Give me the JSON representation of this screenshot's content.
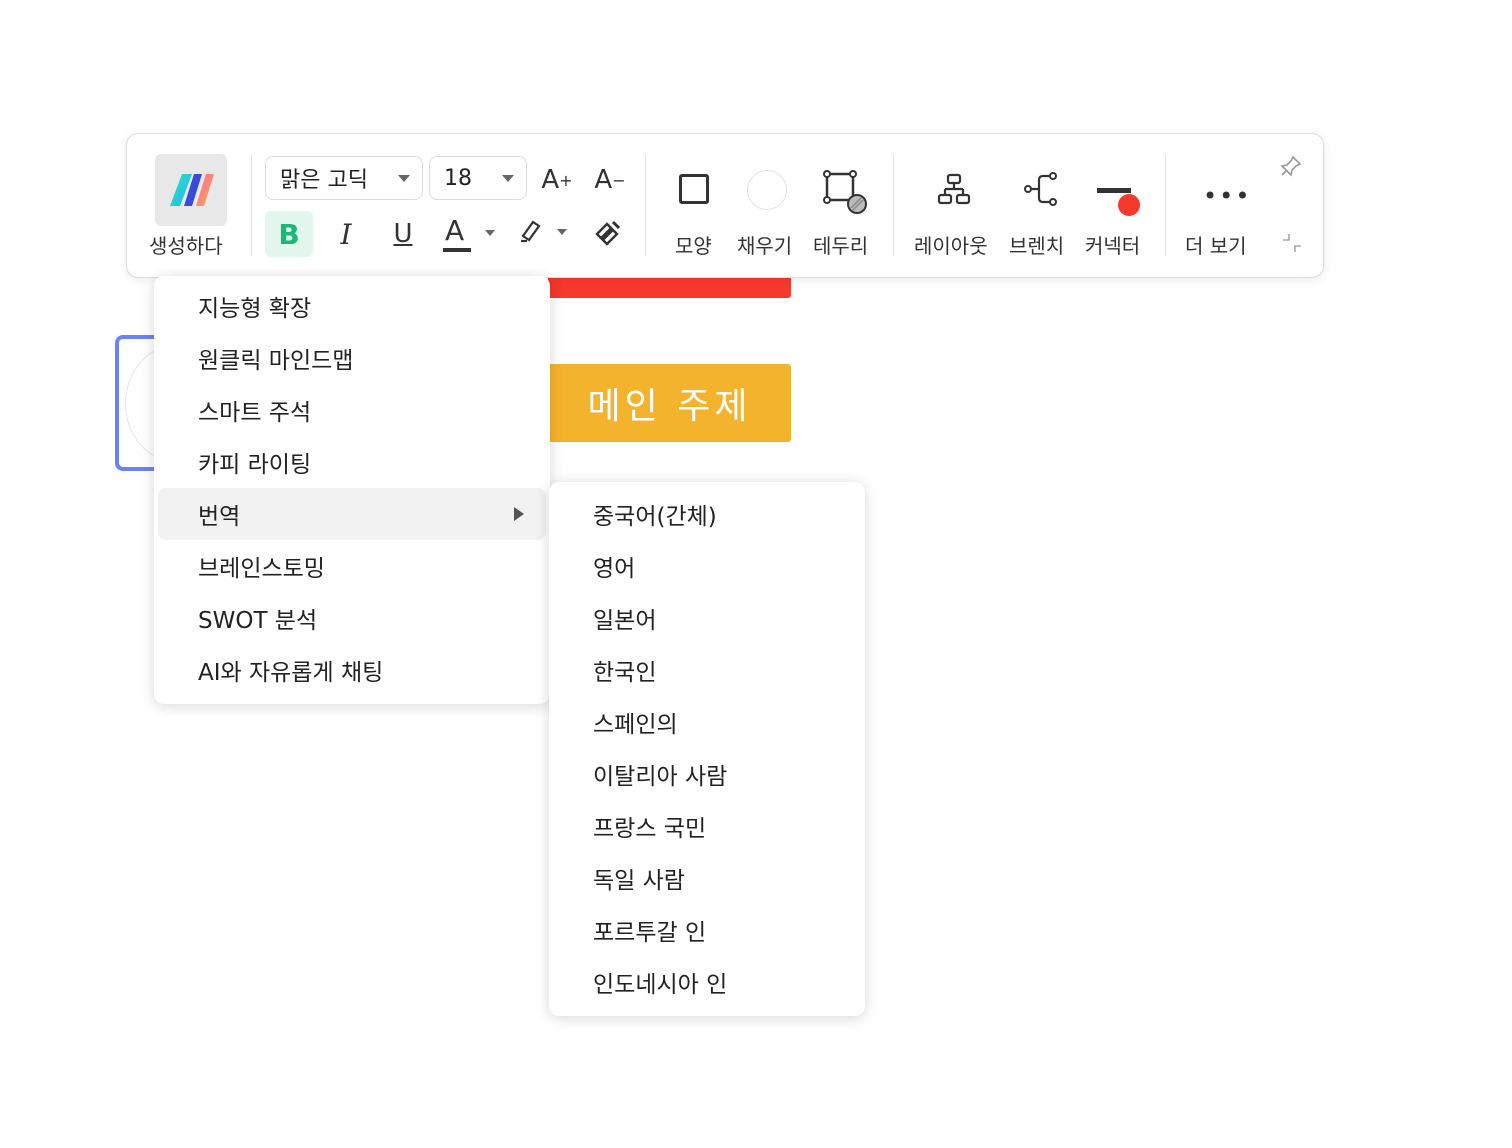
{
  "toolbar": {
    "generate_label": "생성하다",
    "font_family": "맑은 고딕",
    "font_size": "18",
    "font_increase_label": "A",
    "font_decrease_label": "A",
    "bold_label": "B",
    "italic_label": "I",
    "underline_label": "U",
    "font_color_label": "A",
    "shape_label": "모양",
    "fill_label": "채우기",
    "border_label": "테두리",
    "layout_label": "레이아웃",
    "branch_label": "브렌치",
    "connector_label": "커넥터",
    "more_label": "더 보기",
    "connector_color": "#f5392c",
    "accent_color": "#17b978"
  },
  "canvas": {
    "main_topic": "메인 주제",
    "main_topic_color": "#f4b32d",
    "red_topic_color": "#f5392c",
    "selection_color": "#6b82ff"
  },
  "ai_menu": {
    "items": [
      {
        "label": "지능형 확장"
      },
      {
        "label": "원클릭 마인드맵"
      },
      {
        "label": "스마트 주석"
      },
      {
        "label": "카피 라이팅"
      },
      {
        "label": "번역",
        "has_submenu": true,
        "active": true
      },
      {
        "label": "브레인스토밍"
      },
      {
        "label": "SWOT 분석"
      },
      {
        "label": "AI와 자유롭게 채팅"
      }
    ]
  },
  "translate_menu": {
    "items": [
      {
        "label": "중국어(간체)"
      },
      {
        "label": "영어"
      },
      {
        "label": "일본어"
      },
      {
        "label": "한국인"
      },
      {
        "label": "스페인의"
      },
      {
        "label": "이탈리아 사람"
      },
      {
        "label": "프랑스 국민"
      },
      {
        "label": "독일 사람"
      },
      {
        "label": "포르투갈 인"
      },
      {
        "label": "인도네시아 인"
      }
    ]
  }
}
